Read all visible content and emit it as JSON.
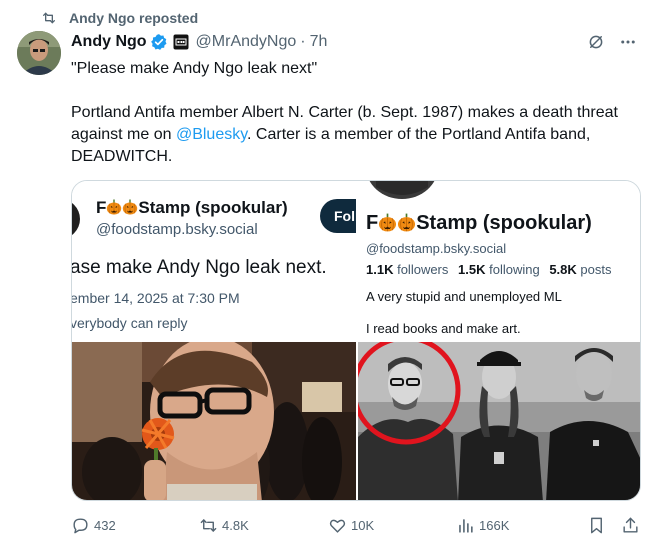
{
  "repost": {
    "label": "Andy Ngo reposted",
    "icon": "repost-icon"
  },
  "author": {
    "name": "Andy Ngo",
    "handle": "@MrAndyNgo",
    "separator": "·",
    "time": "7h",
    "verified": true,
    "badge_color": "#1d9bf0"
  },
  "tweet": {
    "line1": "\"Please make Andy Ngo leak next\"",
    "line2_pre": "Portland Antifa member Albert N. Carter (b. Sept. 1987) makes a death threat against me on ",
    "mention": "@Bluesky",
    "line2_post": ". Carter is a member of the Portland Antifa band, DEADWITCH."
  },
  "embed_left": {
    "name_prefix": "F",
    "name_suffix": "Stamp (spookular)",
    "handle": "@foodstamp.bsky.social",
    "follow_label": "Follow",
    "post_text": "ase make Andy Ngo leak next.",
    "date": "ember 14, 2025 at 7:30 PM",
    "reply_setting": "verybody can reply"
  },
  "embed_right": {
    "name_prefix": "F",
    "name_suffix": "Stamp (spookular)",
    "handle": "@foodstamp.bsky.social",
    "followers_count": "1.1K",
    "followers_label": "followers",
    "following_count": "1.5K",
    "following_label": "following",
    "posts_count": "5.8K",
    "posts_label": "posts",
    "bio_line1": "A very stupid and unemployed ML",
    "bio_line2": "I read books and make art."
  },
  "actions": {
    "replies": "432",
    "reposts": "4.8K",
    "likes": "10K",
    "views": "166K"
  },
  "colors": {
    "accent": "#1d9bf0",
    "text": "#0f1419",
    "muted": "#536471",
    "border": "#cfd9de",
    "highlight_circle": "#e0141e"
  }
}
